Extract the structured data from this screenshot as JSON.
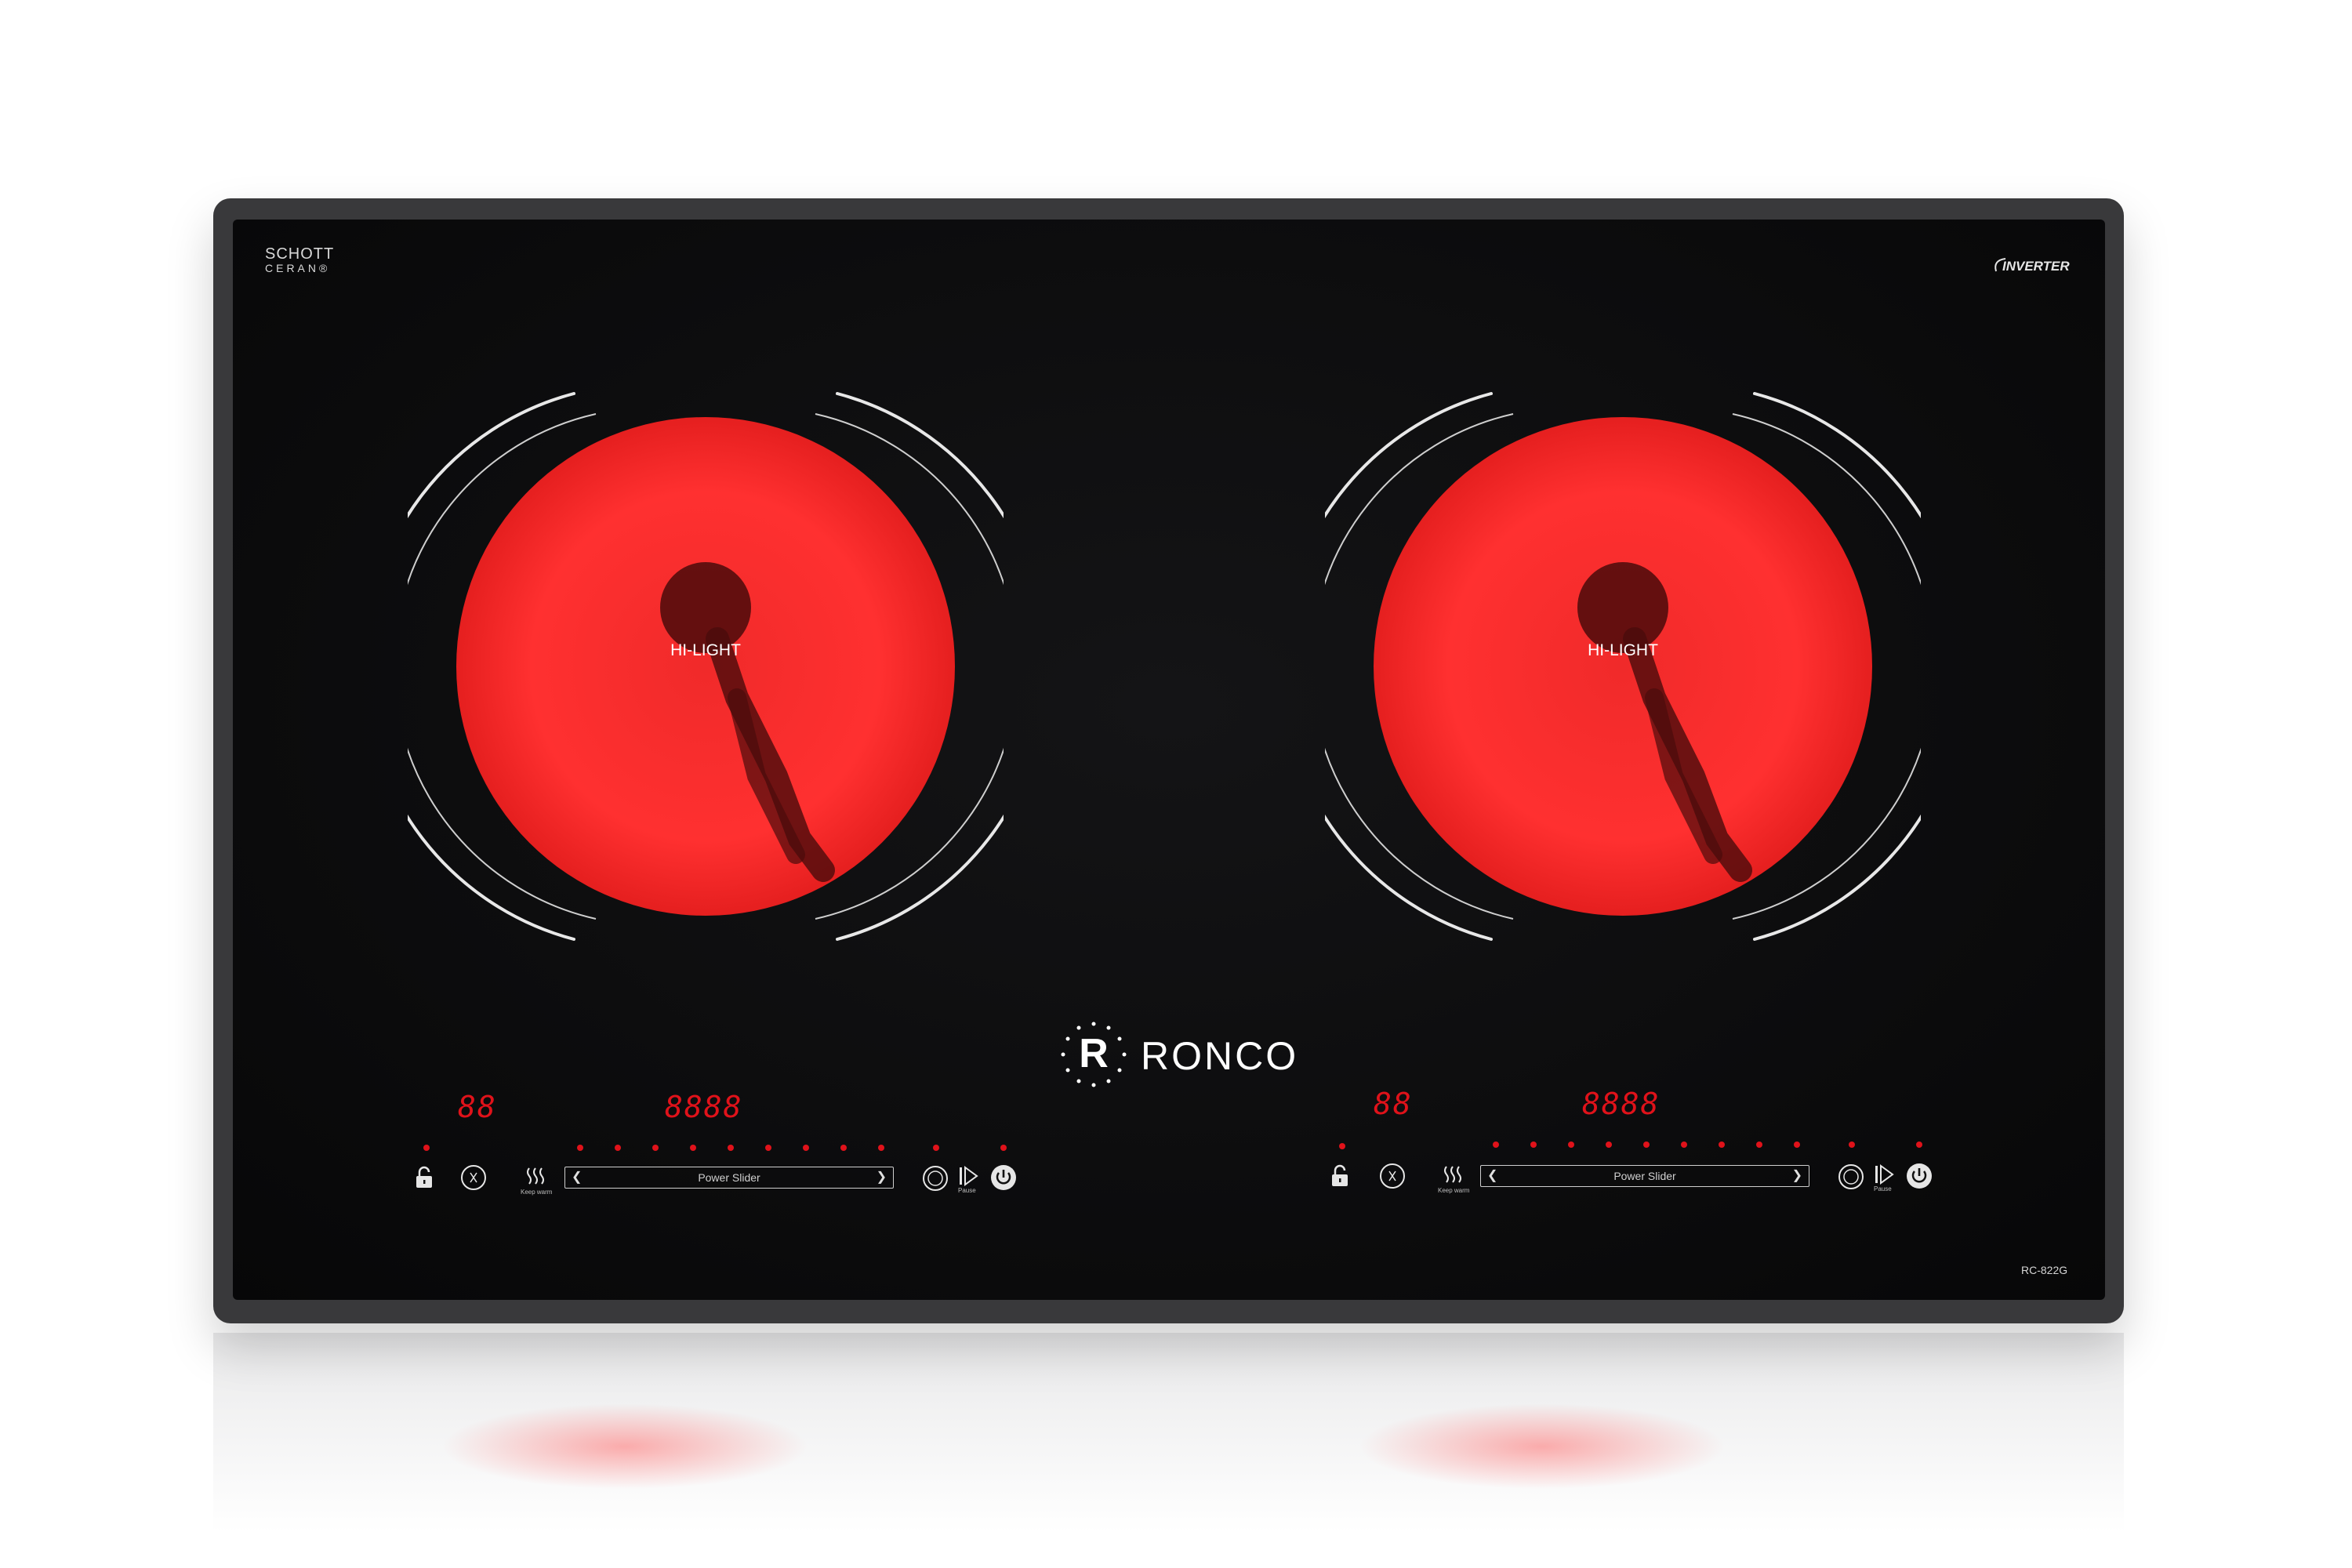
{
  "brand": {
    "name": "RONCO",
    "logo_letter": "R",
    "glass_brand_line1": "SCHOTT",
    "glass_brand_line2": "CERAN®",
    "inverter": "INVERTER",
    "model": "RC-822G"
  },
  "burners": [
    {
      "label": "HI-LIGHT",
      "glow_color": "#ff2b2b"
    },
    {
      "label": "HI-LIGHT",
      "glow_color": "#ff2b2b"
    }
  ],
  "controls": [
    {
      "timer_display": "88",
      "power_display": "8888",
      "slider_label": "Power Slider",
      "keep_warm_label": "Keep warm",
      "pause_label": "Pause"
    },
    {
      "timer_display": "88",
      "power_display": "8888",
      "slider_label": "Power Slider",
      "keep_warm_label": "Keep warm",
      "pause_label": "Pause"
    }
  ],
  "icons": {
    "lock": "lock-icon",
    "timer": "timer-icon",
    "keep_warm": "keep-warm-icon",
    "menu": "menu-icon",
    "pause": "pause-icon",
    "power": "power-icon"
  },
  "colors": {
    "glass": "#0b0b0c",
    "frame": "#39393b",
    "led_red": "#e0121a",
    "burner_red": "#ff2b2b"
  }
}
